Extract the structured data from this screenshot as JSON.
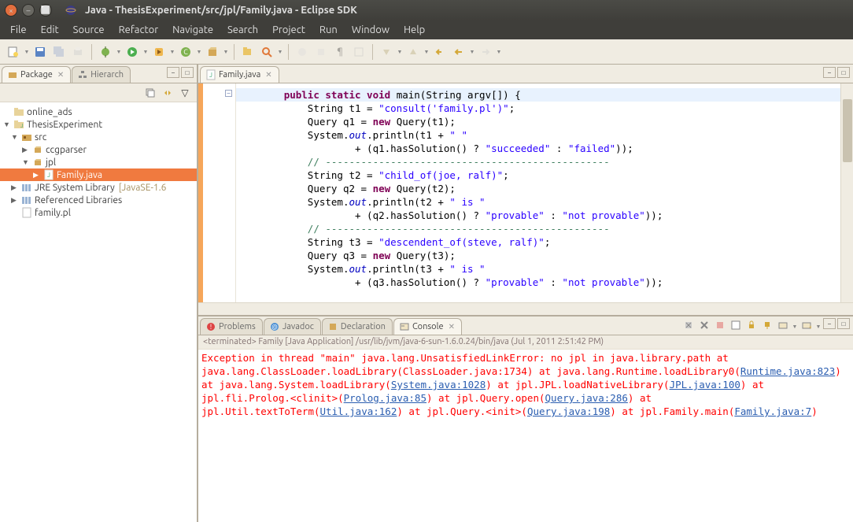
{
  "window": {
    "title": "Java - ThesisExperiment/src/jpl/Family.java - Eclipse SDK",
    "menus": [
      "File",
      "Edit",
      "Source",
      "Refactor",
      "Navigate",
      "Search",
      "Project",
      "Run",
      "Window",
      "Help"
    ]
  },
  "package_explorer": {
    "tab1": "Package",
    "tab2": "Hierarch",
    "items": {
      "online_ads": "online_ads",
      "thesis": "ThesisExperiment",
      "src": "src",
      "ccgparser": "ccgparser",
      "jpl": "jpl",
      "family_java": "Family.java",
      "jre": "JRE System Library",
      "jre_hint": "[JavaSE-1.6",
      "reflib": "Referenced Libraries",
      "family_pl": "family.pl"
    }
  },
  "editor": {
    "tab": "Family.java",
    "code_lines": {
      "l0a": "public",
      "l0b": " static",
      "l0c": " void",
      "l0d": " main(String argv[]) {",
      "l1a": "String t1 = ",
      "l1b": "\"consult('family.pl')\"",
      "l1c": ";",
      "l2a": "Query q1 = ",
      "l2b": "new",
      "l2c": " Query(t1);",
      "l3a": "System.",
      "l3b": "out",
      "l3c": ".println(t1 + ",
      "l3d": "\" \"",
      "l4a": "+ (q1.hasSolution() ? ",
      "l4b": "\"succeeded\"",
      "l4c": " : ",
      "l4d": "\"failed\"",
      "l4e": "));",
      "l5": "// ------------------------------------------------",
      "l6a": "String t2 = ",
      "l6b": "\"child_of(joe, ralf)\"",
      "l6c": ";",
      "l7a": "Query q2 = ",
      "l7b": "new",
      "l7c": " Query(t2);",
      "l8a": "System.",
      "l8b": "out",
      "l8c": ".println(t2 + ",
      "l8d": "\" is \"",
      "l9a": "+ (q2.hasSolution() ? ",
      "l9b": "\"provable\"",
      "l9c": " : ",
      "l9d": "\"not provable\"",
      "l9e": "));",
      "l10": "// ------------------------------------------------",
      "l11a": "String t3 = ",
      "l11b": "\"descendent_of(steve, ralf)\"",
      "l11c": ";",
      "l12a": "Query q3 = ",
      "l12b": "new",
      "l12c": " Query(t3);",
      "l13a": "System.",
      "l13b": "out",
      "l13c": ".println(t3 + ",
      "l13d": "\" is \"",
      "l14a": "+ (q3.hasSolution() ? ",
      "l14b": "\"provable\"",
      "l14c": " : ",
      "l14d": "\"not provable\"",
      "l14e": "));"
    }
  },
  "bottom": {
    "tab_problems": "Problems",
    "tab_javadoc": "Javadoc",
    "tab_declaration": "Declaration",
    "tab_console": "Console",
    "launch": "<terminated> Family [Java Application] /usr/lib/jvm/java-6-sun-1.6.0.24/bin/java (Jul 1, 2011 2:51:42 PM)",
    "lines": {
      "e0": "Exception in thread \"main\" java.lang.UnsatisfiedLinkError: no jpl in java.library.path",
      "e1": "        at java.lang.ClassLoader.loadLibrary(ClassLoader.java:1734)",
      "e2a": "        at java.lang.Runtime.loadLibrary0(",
      "e2b": "Runtime.java:823",
      "e2c": ")",
      "e3a": "        at java.lang.System.loadLibrary(",
      "e3b": "System.java:1028",
      "e3c": ")",
      "e4a": "        at jpl.JPL.loadNativeLibrary(",
      "e4b": "JPL.java:100",
      "e4c": ")",
      "e5a": "        at jpl.fli.Prolog.<clinit>(",
      "e5b": "Prolog.java:85",
      "e5c": ")",
      "e6a": "        at jpl.Query.open(",
      "e6b": "Query.java:286",
      "e6c": ")",
      "e7a": "        at jpl.Util.textToTerm(",
      "e7b": "Util.java:162",
      "e7c": ")",
      "e8a": "        at jpl.Query.<init>(",
      "e8b": "Query.java:198",
      "e8c": ")",
      "e9a": "        at jpl.Family.main(",
      "e9b": "Family.java:7",
      "e9c": ")"
    }
  }
}
